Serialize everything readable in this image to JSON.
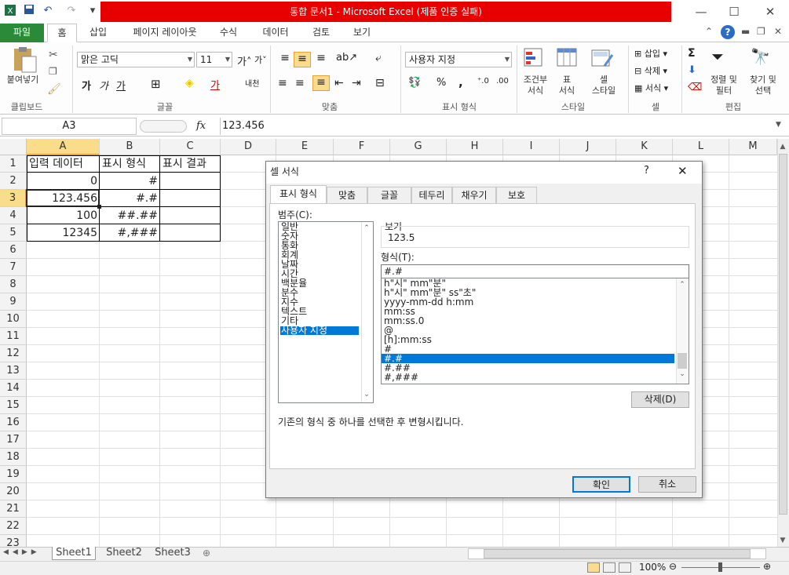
{
  "window": {
    "title": "통합 문서1  -  Microsoft Excel (제품 인증 실패)",
    "controls": {
      "minimize": "—",
      "restore": "☐",
      "close": "✕"
    }
  },
  "ribbon_tabs": [
    "파일",
    "홈",
    "삽입",
    "페이지 레이아웃",
    "수식",
    "데이터",
    "검토",
    "보기"
  ],
  "ribbon": {
    "clipboard": {
      "paste": "붙여넣기",
      "group": "클립보드"
    },
    "font": {
      "name": "맑은 고딕",
      "size": "11",
      "bold": "가",
      "italic": "가",
      "underline": "가",
      "group": "글꼴"
    },
    "align": {
      "group": "맞춤"
    },
    "number": {
      "format": "사용자 지정",
      "percent": "%",
      "comma": ",",
      "group": "표시 형식"
    },
    "style": {
      "cond": "조건부\n서식",
      "table": "표\n서식",
      "cell": "셀\n스타일",
      "group": "스타일"
    },
    "cells": {
      "insert": "삽입",
      "delete": "삭제",
      "format": "서식",
      "group": "셀"
    },
    "edit": {
      "sum": "Σ",
      "sort": "정렬 및\n필터",
      "find": "찾기 및\n선택",
      "group": "편집"
    }
  },
  "formula_bar": {
    "name_box": "A3",
    "fx": "fx",
    "value": "123.456"
  },
  "columns": [
    "A",
    "B",
    "C",
    "D",
    "E",
    "F",
    "G",
    "H",
    "I",
    "J",
    "K",
    "L",
    "M"
  ],
  "rows": [
    "1",
    "2",
    "3",
    "4",
    "5",
    "6",
    "7",
    "8",
    "9",
    "10",
    "11",
    "12",
    "13",
    "14",
    "15",
    "16",
    "17",
    "18",
    "19",
    "20",
    "21",
    "22",
    "23"
  ],
  "cells": {
    "A1": "입력 데이터",
    "B1": "표시 형식",
    "C1": "표시 결과",
    "A2": "0",
    "B2": "#",
    "A3": "123.456",
    "B3": "#.#",
    "A4": "100",
    "B4": "##.##",
    "A5": "12345",
    "B5": "#,###"
  },
  "sheets": [
    "Sheet1",
    "Sheet2",
    "Sheet3"
  ],
  "status": {
    "zoom": "100%"
  },
  "dialog": {
    "title": "셀 서식",
    "help": "?",
    "close": "✕",
    "tabs": [
      "표시 형식",
      "맞춤",
      "글꼴",
      "테두리",
      "채우기",
      "보호"
    ],
    "category_label": "범주(C):",
    "categories": [
      "일반",
      "숫자",
      "통화",
      "회계",
      "날짜",
      "시간",
      "백분율",
      "분수",
      "지수",
      "텍스트",
      "기타",
      "사용자 지정"
    ],
    "selected_category": "사용자 지정",
    "preview_label": "보기",
    "preview_value": "123.5",
    "type_label": "형식(T):",
    "type_value": "#.#",
    "formats": [
      "h\"시\" mm\"분\"",
      "h\"시\" mm\"분\" ss\"초\"",
      "yyyy-mm-dd h:mm",
      "mm:ss",
      "mm:ss.0",
      "@",
      "[h]:mm:ss",
      "#",
      "#.#",
      "#.##",
      "#,###"
    ],
    "selected_format": "#.#",
    "delete_button": "삭제(D)",
    "description": "기존의 형식 중 하나를 선택한 후 변형시킵니다.",
    "ok": "확인",
    "cancel": "취소"
  }
}
